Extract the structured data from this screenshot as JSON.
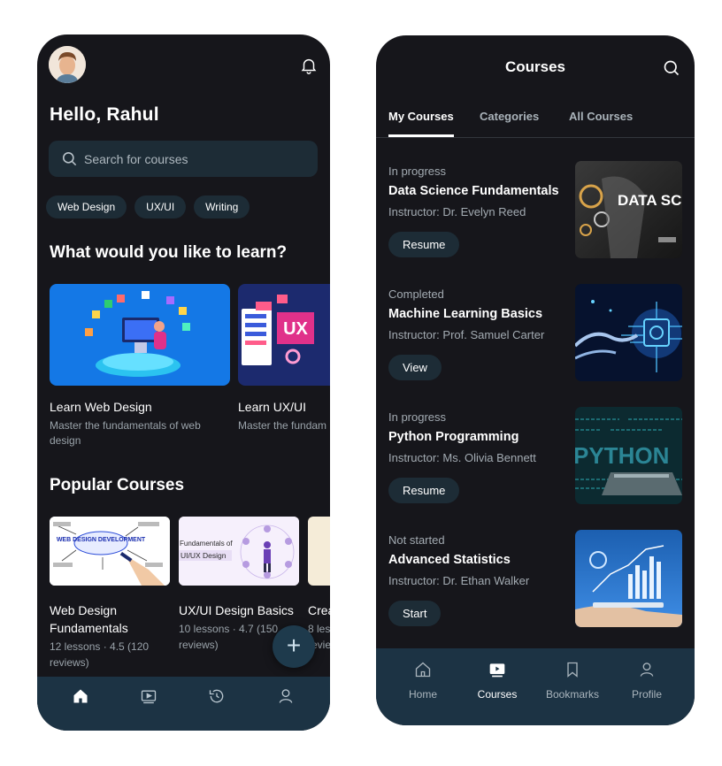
{
  "home": {
    "greeting": "Hello, Rahul",
    "search_placeholder": "Search for courses",
    "chips": [
      "Web Design",
      "UX/UI",
      "Writing"
    ],
    "learn_section_title": "What would you like to learn?",
    "learn_cards": [
      {
        "title": "Learn Web Design",
        "desc": "Master the fundamentals of web design"
      },
      {
        "title": "Learn UX/UI",
        "desc": "Master the fundam",
        "thumb_text": "UX"
      }
    ],
    "popular_title": "Popular Courses",
    "popular_cards": [
      {
        "title": "Web Design Fundamentals",
        "meta": "12 lessons · 4.5 (120 reviews)",
        "thumb_text": "WEB DESIGN DEVELOPMENT"
      },
      {
        "title": "UX/UI Design Basics",
        "meta": "10 lessons · 4.7 (150 reviews)",
        "thumb_line1": "Fundamentals of",
        "thumb_line2": "UI/UX Design"
      },
      {
        "title": "Crea",
        "meta": "8 les revie"
      }
    ],
    "fab_label": "+",
    "nav": [
      "home-icon",
      "video-icon",
      "history-icon",
      "profile-icon"
    ],
    "accent": "#1c3344"
  },
  "courses": {
    "title": "Courses",
    "tabs": [
      "My Courses",
      "Categories",
      "All Courses"
    ],
    "active_tab": "My Courses",
    "items": [
      {
        "status": "In progress",
        "name": "Data Science Fundamentals",
        "instructor": "Instructor: Dr. Evelyn Reed",
        "action": "Resume",
        "image_text": "DATA SCIENCE"
      },
      {
        "status": "Completed",
        "name": "Machine Learning Basics",
        "instructor": "Instructor: Prof. Samuel Carter",
        "action": "View"
      },
      {
        "status": "In progress",
        "name": "Python Programming",
        "instructor": "Instructor: Ms. Olivia Bennett",
        "action": "Resume",
        "image_text": "PYTHON"
      },
      {
        "status": "Not started",
        "name": "Advanced Statistics",
        "instructor": "Instructor: Dr. Ethan Walker",
        "action": "Start"
      }
    ],
    "nav": [
      {
        "label": "Home",
        "icon": "home-icon"
      },
      {
        "label": "Courses",
        "icon": "play-icon"
      },
      {
        "label": "Bookmarks",
        "icon": "bookmark-icon"
      },
      {
        "label": "Profile",
        "icon": "profile-icon"
      }
    ],
    "active_nav": "Courses"
  }
}
